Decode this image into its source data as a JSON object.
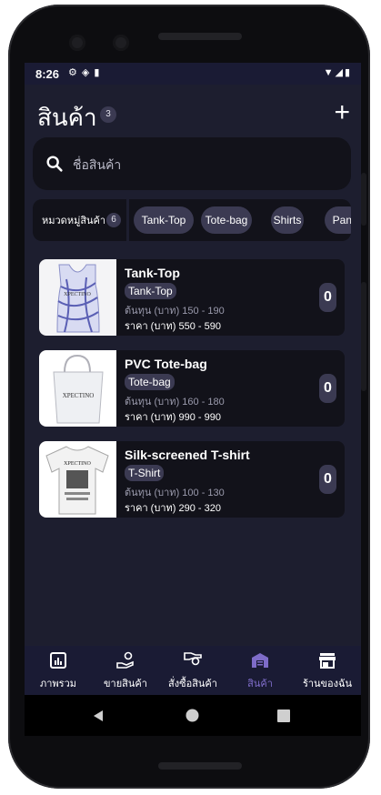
{
  "status": {
    "time": "8:26"
  },
  "header": {
    "title": "สินค้า",
    "count": "3",
    "add_symbol": "+"
  },
  "search": {
    "placeholder": "ชื่อสินค้า"
  },
  "categories": {
    "label": "หมวดหมู่สินค้า",
    "count": "6",
    "chips": [
      "Tank-Top",
      "Tote-bag",
      "Shirts",
      "Pant"
    ]
  },
  "products": [
    {
      "name": "Tank-Top",
      "tag": "Tank-Top",
      "cost": "ต้นทุน (บาท) 150 - 190",
      "price": "ราคา (บาท) 550 - 590",
      "qty": "0"
    },
    {
      "name": "PVC Tote-bag",
      "tag": "Tote-bag",
      "cost": "ต้นทุน (บาท) 160 - 180",
      "price": "ราคา (บาท) 990 - 990",
      "qty": "0"
    },
    {
      "name": "Silk-screened T-shirt",
      "tag": "T-Shirt",
      "cost": "ต้นทุน (บาท) 100 - 130",
      "price": "ราคา (บาท) 290 - 320",
      "qty": "0"
    }
  ],
  "product_images": {
    "brand_text": "XPECTINO"
  },
  "nav": {
    "items": [
      "ภาพรวม",
      "ขายสินค้า",
      "สั่งซื้อสินค้า",
      "สินค้า",
      "ร้านของฉัน"
    ],
    "active": "สินค้า"
  },
  "colors": {
    "background": "#1d1e2f",
    "card": "#12121a",
    "chip": "#3b3a52",
    "accent": "#7e6cc8",
    "bar": "#1a1b34"
  }
}
